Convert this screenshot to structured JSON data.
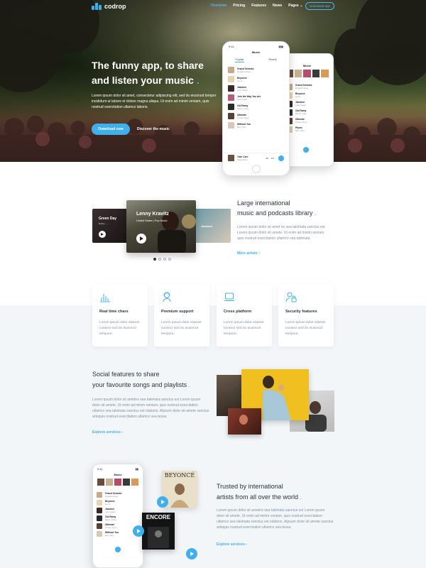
{
  "nav": {
    "brand": "codrop",
    "menu": [
      "Overview",
      "Pricing",
      "Features",
      "News",
      "Pages"
    ],
    "cta": "Download app"
  },
  "hero": {
    "title_line1": "The funny app, to share",
    "title_line2": "and listen your music",
    "description": "Lorem ipsum dolor sit amet, consectetur adipiscing elit, sed do eiusmod tempor incididunt ut labore et dolore magna aliqua. Ut enim ad minim veniam, quis nostrud exercitation ullamco laboris.",
    "primary_button": "Download now",
    "secondary_button": "Discover the music"
  },
  "phone_main": {
    "title": "Music",
    "tabs": [
      "Popular",
      "Recent"
    ],
    "songs": [
      {
        "title": "Grand Schedul",
        "artist": "Regelsrinking",
        "color": "#c9a98a"
      },
      {
        "title": "Beyonce",
        "artist": "Lemo",
        "color": "#e8d3b0"
      },
      {
        "title": "Jasmine",
        "artist": "Lady Gaga",
        "color": "#3a2a2a"
      },
      {
        "title": "Join the Way You Are",
        "artist": "Hansi Pilip",
        "color": "#b85a7a"
      },
      {
        "title": "Old Ramy",
        "artist": "Music Cube",
        "color": "#2a2a2a"
      },
      {
        "title": "Ultimate",
        "artist": "Ocean Ryan",
        "color": "#5a4030"
      },
      {
        "title": "Without You",
        "artist": "Elmy Boy",
        "color": "#d8c8b8"
      }
    ],
    "now_playing": {
      "title": "Take Care",
      "artist": "Music Bros"
    }
  },
  "phone_back": {
    "title": "Music",
    "songs": [
      {
        "title": "Grand Schedul",
        "artist": "Regelsrinking"
      },
      {
        "title": "Beyonce",
        "artist": "Lemo"
      },
      {
        "title": "Jasmine",
        "artist": "Lady Gaga"
      },
      {
        "title": "Old Ramy",
        "artist": "Music Cube"
      },
      {
        "title": "Ultimate",
        "artist": "Ocean Ryan"
      },
      {
        "title": "Plume",
        "artist": "Elmy Boy"
      }
    ]
  },
  "artists": {
    "left": {
      "name": "Green Day",
      "sub": "Ruthie - ..."
    },
    "center": {
      "name": "Lenny Kravitz",
      "sub": "United States | Pop Music"
    },
    "right": {
      "name": "Jackson",
      "sub": ""
    }
  },
  "library": {
    "title_line1": "Large international",
    "title_line2": "music and podcasts library",
    "description": "Lorem ipsum dolor sit amet no sea takimata sanctus est Lorem ipsum dolor sit amete. Ut enim ad minim veniam, quis nostrud exercitation ullamco sea takimata.",
    "link": "More artists"
  },
  "features": [
    {
      "icon": "bar-chart-icon",
      "title": "Real time chars",
      "description": "Lorem ipsum dolor sitamet consect sed do eiusmod tempore."
    },
    {
      "icon": "support-agent-icon",
      "title": "Premium support",
      "description": "Lorem ipsum dolor sitamet consect sed do eiusmod tempore."
    },
    {
      "icon": "laptop-icon",
      "title": "Cross platform",
      "description": "Lorem ipsum dolor sitamet consect sed do eiusmod tempore."
    },
    {
      "icon": "user-lock-icon",
      "title": "Security features",
      "description": "Lorem ipsum dolor sitamet consect sed do eiusmod tempore."
    }
  ],
  "social": {
    "title_line1": "Social features to share",
    "title_line2": "your favourite songs and playlists",
    "description": "Lorem ipsum dolor sit ametno sea takimata sanctus est Lorem ipsum dolor sit amete. Ut enim ad minim veniam, quis nostrud exercitation ullamco sea takimata sanctus est elaboris. Alpsum dolor sit amete sanctus artequis nostrud exercitation ullamco sea tessa.",
    "link": "Explore services"
  },
  "trusted": {
    "title_line1": "Trusted by international",
    "title_line2": "artists from all over the world",
    "description": "Lorem ipsum dolor sit ametno sea takimata sanctus est Lorem ipsum dolor sit amete. Ut enim ad minim veniam, quis nostrud exercitation ullamco sea takimata sanctus est elaboris. Alpsum dolor sit amete sanctus artequis nostrud exercitation ullamco sea tessa.",
    "link": "Explore services",
    "album1": "BEYONCÉ",
    "album2": "ENCORE"
  },
  "colors": {
    "accent": "#3fb0ec",
    "dark": "#2a3440"
  }
}
